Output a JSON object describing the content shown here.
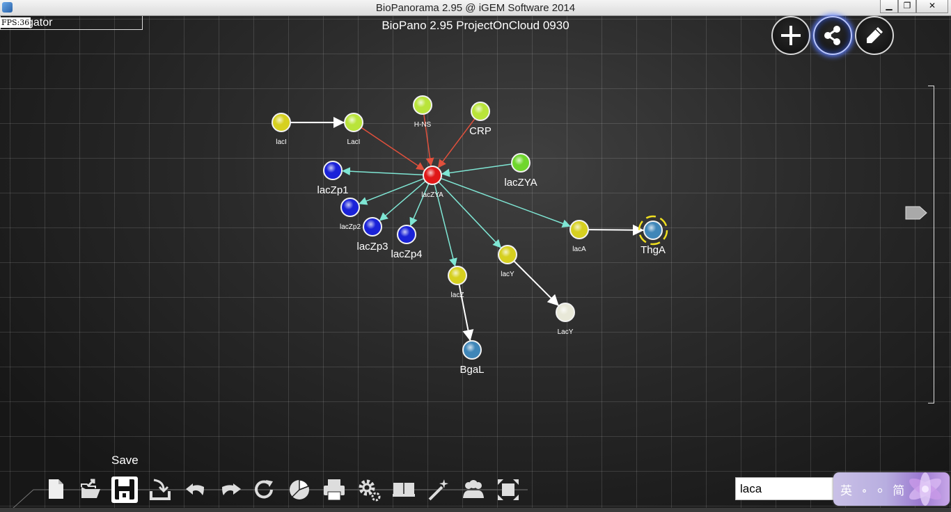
{
  "window": {
    "title": "BioPanorama 2.95 @ iGEM Software 2014",
    "minimize": "▁",
    "restore": "❐",
    "close": "✕"
  },
  "overlay": {
    "fps": "FPS:36",
    "navigator": "gator",
    "project_title": "BioPano 2.95 ProjectOnCloud 0930"
  },
  "mode_buttons": [
    {
      "name": "add-node",
      "icon": "plus-icon"
    },
    {
      "name": "link",
      "icon": "share-icon",
      "active": true
    },
    {
      "name": "edit",
      "icon": "pencil-icon"
    }
  ],
  "graph": {
    "nodes": [
      {
        "id": "lacI_1",
        "label": "lacI",
        "color": "yellow"
      },
      {
        "id": "LacI_2",
        "label": "LacI",
        "color": "lime"
      },
      {
        "id": "H-NS",
        "label": "H-NS",
        "color": "lime"
      },
      {
        "id": "CRP",
        "label": "CRP",
        "color": "lime"
      },
      {
        "id": "lacZYA_center",
        "label": "lacZYA",
        "color": "red"
      },
      {
        "id": "lacZYA_green",
        "label": "lacZYA",
        "color": "green"
      },
      {
        "id": "lacZp1",
        "label": "lacZp1",
        "color": "blue"
      },
      {
        "id": "lacZp2",
        "label": "lacZp2",
        "color": "blue"
      },
      {
        "id": "lacZp3",
        "label": "lacZp3",
        "color": "blue"
      },
      {
        "id": "lacZp4",
        "label": "lacZp4",
        "color": "blue"
      },
      {
        "id": "lacA",
        "label": "lacA",
        "color": "yellow"
      },
      {
        "id": "ThgA",
        "label": "ThgA",
        "color": "steelblue",
        "selected": true
      },
      {
        "id": "lacY",
        "label": "lacY",
        "color": "yellow"
      },
      {
        "id": "LacY",
        "label": "LacY",
        "color": "white"
      },
      {
        "id": "lacZ",
        "label": "lacZ",
        "color": "yellow"
      },
      {
        "id": "BgaL",
        "label": "BgaL",
        "color": "steelblue"
      }
    ],
    "edges": [
      {
        "from": "lacI_1",
        "to": "LacI_2",
        "type": "white"
      },
      {
        "from": "LacI_2",
        "to": "lacZYA_center",
        "type": "red"
      },
      {
        "from": "H-NS",
        "to": "lacZYA_center",
        "type": "red"
      },
      {
        "from": "CRP",
        "to": "lacZYA_center",
        "type": "red"
      },
      {
        "from": "lacZYA_green",
        "to": "lacZYA_center",
        "type": "teal"
      },
      {
        "from": "lacZYA_center",
        "to": "lacZp1",
        "type": "teal"
      },
      {
        "from": "lacZYA_center",
        "to": "lacZp2",
        "type": "teal"
      },
      {
        "from": "lacZYA_center",
        "to": "lacZp3",
        "type": "teal"
      },
      {
        "from": "lacZYA_center",
        "to": "lacZp4",
        "type": "teal"
      },
      {
        "from": "lacZYA_center",
        "to": "lacZ",
        "type": "teal"
      },
      {
        "from": "lacZYA_center",
        "to": "lacY",
        "type": "teal"
      },
      {
        "from": "lacZYA_center",
        "to": "lacA",
        "type": "teal"
      },
      {
        "from": "lacA",
        "to": "ThgA",
        "type": "white"
      },
      {
        "from": "lacY",
        "to": "LacY",
        "type": "white"
      },
      {
        "from": "lacZ",
        "to": "BgaL",
        "type": "white"
      }
    ]
  },
  "colors": {
    "yellow": "#d6d020",
    "lime": "#b9e43a",
    "green": "#6fd62c",
    "red": "#e01818",
    "blue": "#1a22d8",
    "steelblue": "#3f86b8",
    "white": "#e8e8d8",
    "edge_red": "#e0503c",
    "edge_teal": "#7fe6d4",
    "edge_white": "#ffffff",
    "selection": "#f0e020",
    "active_glow": "#5b7cff"
  },
  "toolbar": {
    "tooltip": "Save",
    "items": [
      {
        "name": "new",
        "icon": "new-file-icon"
      },
      {
        "name": "open",
        "icon": "open-folder-icon"
      },
      {
        "name": "save",
        "icon": "save-icon",
        "selected": true
      },
      {
        "name": "export",
        "icon": "export-icon"
      },
      {
        "name": "undo",
        "icon": "undo-icon"
      },
      {
        "name": "redo",
        "icon": "redo-icon"
      },
      {
        "name": "refresh",
        "icon": "refresh-icon"
      },
      {
        "name": "pie",
        "icon": "pie-chart-icon"
      },
      {
        "name": "print",
        "icon": "printer-icon"
      },
      {
        "name": "settings",
        "icon": "gear-icon"
      },
      {
        "name": "book",
        "icon": "book-icon"
      },
      {
        "name": "wand",
        "icon": "magic-wand-icon"
      },
      {
        "name": "users",
        "icon": "users-icon"
      },
      {
        "name": "fit",
        "icon": "fit-screen-icon"
      }
    ]
  },
  "search": {
    "value": "laca"
  },
  "ime": {
    "text": "英 ∘ ⸰ 简"
  }
}
